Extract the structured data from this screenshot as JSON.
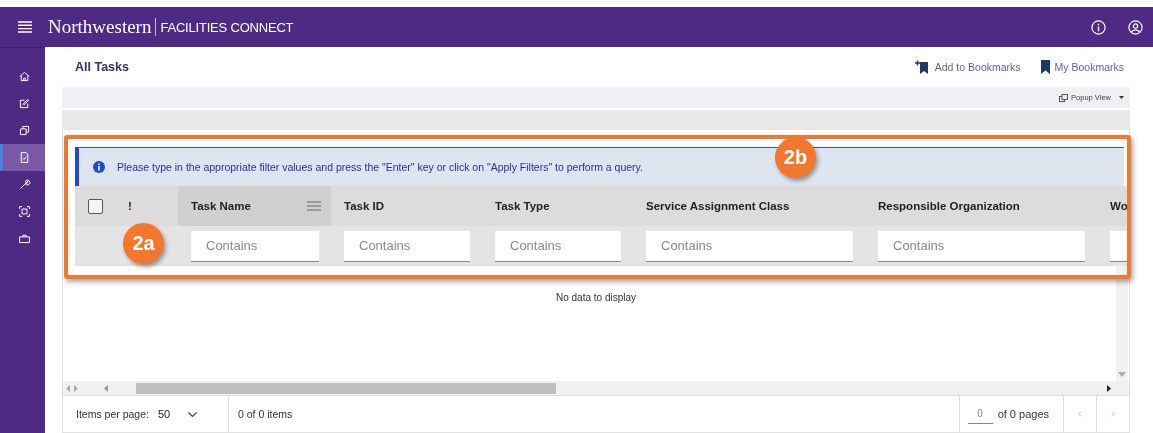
{
  "app": {
    "brand": "Northwestern",
    "product": "FACILITIES CONNECT"
  },
  "sidebar": {
    "items": [
      {
        "kind": "home",
        "selected": false
      },
      {
        "kind": "edit",
        "selected": false
      },
      {
        "kind": "copy",
        "selected": false
      },
      {
        "kind": "document",
        "selected": true
      },
      {
        "kind": "wrench",
        "selected": false
      },
      {
        "kind": "scan",
        "selected": false
      },
      {
        "kind": "briefcase",
        "selected": false
      }
    ]
  },
  "page": {
    "title": "All Tasks",
    "actions": [
      {
        "kind": "add-bookmark",
        "label": "Add to Bookmarks"
      },
      {
        "kind": "bookmark",
        "label": "My Bookmarks"
      }
    ],
    "view_menu": "Popup View"
  },
  "info_banner": "Please type in the appropriate filter values and press the \"Enter\" key or click on \"Apply Filters\" to perform a query.",
  "table": {
    "select_all": {
      "checked": false
    },
    "columns": [
      {
        "label": "!",
        "selected": false,
        "filter": false
      },
      {
        "label": "Task Name",
        "selected": true,
        "filter": true,
        "placeholder": "Contains"
      },
      {
        "label": "Task ID",
        "selected": false,
        "filter": true,
        "placeholder": "Contains"
      },
      {
        "label": "Task Type",
        "selected": false,
        "filter": true,
        "placeholder": "Contains"
      },
      {
        "label": "Service Assignment Class",
        "selected": false,
        "filter": true,
        "placeholder": "Contains"
      },
      {
        "label": "Responsible Organization",
        "selected": false,
        "filter": true,
        "placeholder": "Contains"
      },
      {
        "label": "Wo",
        "selected": false,
        "filter": true
      }
    ],
    "empty_message": "No data to display"
  },
  "pagination": {
    "items_per_page_label": "Items per page:",
    "items_per_page": "50",
    "item_count": "0 of 0 items",
    "page": "0",
    "page_count": "of 0 pages"
  },
  "callouts": [
    {
      "label": "2a"
    },
    {
      "label": "2b"
    }
  ]
}
